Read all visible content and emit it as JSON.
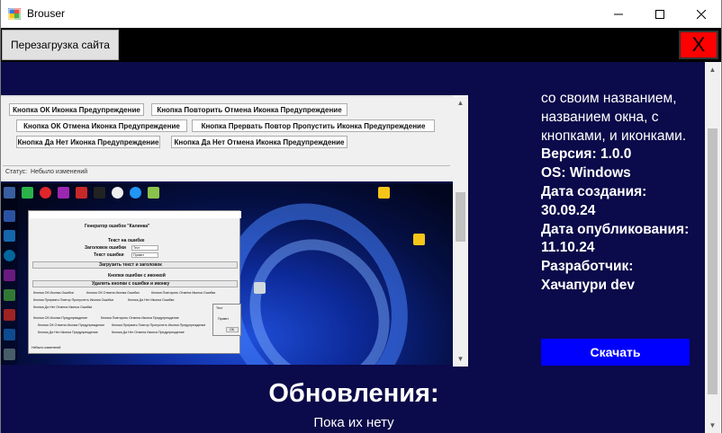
{
  "window": {
    "title": "Brouser"
  },
  "toolbar": {
    "reload_label": "Перезагрузка сайта",
    "close_label": "X"
  },
  "preview": {
    "buttons_row1": [
      "Кнопка ОК Иконка Предупреждение",
      "Кнопка Повторить Отмена Иконка Предупреждение"
    ],
    "buttons_row2": [
      "Кнопка ОК Отмена Иконка Предупреждение",
      "Кнопка Прервать Повтор Пропустить Иконка Предупреждение"
    ],
    "buttons_row3": [
      "Кнопка Да Нет Иконка Предупреждение",
      "Кнопка Да Нет Отмена Иконка Предупреждение"
    ],
    "status_label": "Статус:",
    "status_value": "Небыло изменений",
    "generator": {
      "title": "Генератор ошибок \"Калинка\"",
      "error_text_label": "Текст на ошибке",
      "header_label": "Заголовок ошибки",
      "header_value": "Тест",
      "error_text_field_label": "Текст ошибки",
      "error_text_value": "Привет",
      "load_button": "Загрузить текст и заголовок",
      "icon_buttons_label": "Кнопки ошибки с иконкой",
      "delete_button": "Удалить кнопки с ошибки и иконку",
      "row1": [
        "Кнопка ОК Иконка Ошибки",
        "Кнопка ОК Отмена Иконка Ошибки",
        "Кнопка Повторить Отмена Иконка Ошибки"
      ],
      "row2": [
        "Кнопка Прервать Повтор Пропустить Иконка Ошибки",
        "Кнопка Да Нет Иконка Ошибки"
      ],
      "row3": [
        "Кнопка Да Нет Отмена Иконка Ошибки"
      ],
      "row4": [
        "Кнопка ОК Иконка Предупреждение",
        "Кнопка Повторить Отмена Иконка Предупреждение"
      ],
      "row5": [
        "Кнопка ОК Отмена Иконка Предупреждение",
        "Кнопка Прервать Повтор Пропустить Иконка Предупреждение"
      ],
      "row6": [
        "Кнопка Да Нет Иконка Предупреждение",
        "Кнопка Да Нет Отмена Иконка Предупреждение"
      ]
    },
    "dialog": {
      "title": "Тест",
      "text": "Привет",
      "ok": "ОК"
    }
  },
  "info": {
    "description": "со своим названием, названием окна, с кнопками, и иконками.",
    "version": "Версия: 1.0.0",
    "os": "OS: Windows",
    "created": "Дата создания: 30.09.24",
    "published": "Дата опубликования: 11.10.24",
    "developer": "Разработчик: Хачапури dev",
    "download_label": "Скачать"
  },
  "updates": {
    "title": "Обновления:",
    "text": "Пока их нету"
  },
  "colors": {
    "page_bg": "#0b0a4a",
    "download_bg": "#0000ff",
    "close_bg": "#ff0000"
  }
}
